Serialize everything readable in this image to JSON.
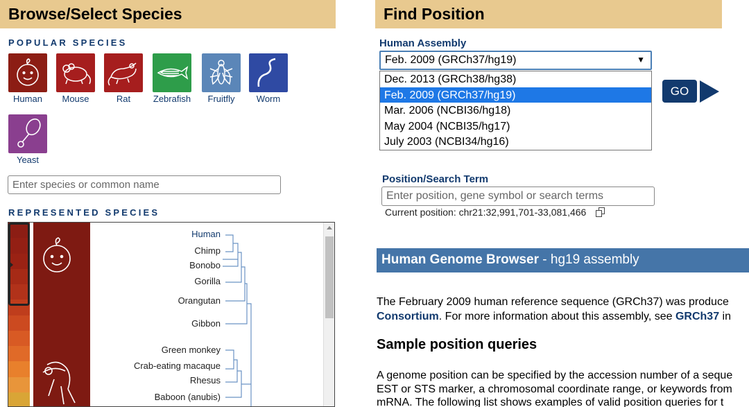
{
  "browse": {
    "title": "Browse/Select Species",
    "popular_label": "POPULAR SPECIES",
    "popular_species": [
      {
        "name": "Human",
        "color": "#8c1d14",
        "icon": "human-icon"
      },
      {
        "name": "Mouse",
        "color": "#a61e1e",
        "icon": "mouse-icon"
      },
      {
        "name": "Rat",
        "color": "#a61e1e",
        "icon": "rat-icon"
      },
      {
        "name": "Zebrafish",
        "color": "#2e9d4a",
        "icon": "zebrafish-icon"
      },
      {
        "name": "Fruitfly",
        "color": "#5b86b8",
        "icon": "fruitfly-icon"
      },
      {
        "name": "Worm",
        "color": "#2f4aa3",
        "icon": "worm-icon"
      },
      {
        "name": "Yeast",
        "color": "#8a3f8f",
        "icon": "yeast-icon"
      }
    ],
    "species_placeholder": "Enter species or common name",
    "represented_label": "REPRESENTED SPECIES",
    "tree_species": [
      "Human",
      "Chimp",
      "Bonobo",
      "Gorilla",
      "Orangutan",
      "Gibbon",
      "Green monkey",
      "Crab-eating macaque",
      "Rhesus",
      "Baboon (anubis)"
    ],
    "strip_colors": [
      "#8c1d14",
      "#931f14",
      "#9a2214",
      "#a62a16",
      "#b1321a",
      "#bf3d1c",
      "#cc4a20",
      "#d85a24",
      "#e06a28",
      "#e8802c",
      "#e8953a",
      "#d9a536"
    ]
  },
  "find": {
    "title": "Find Position",
    "assembly_label": "Human Assembly",
    "selected_assembly": "Feb. 2009 (GRCh37/hg19)",
    "assembly_options": [
      "Dec. 2013 (GRCh38/hg38)",
      "Feb. 2009 (GRCh37/hg19)",
      "Mar. 2006 (NCBI36/hg18)",
      "May 2004 (NCBI35/hg17)",
      "July 2003 (NCBI34/hg16)"
    ],
    "go_label": "GO",
    "search_label": "Position/Search Term",
    "search_placeholder": "Enter position, gene symbol or search terms",
    "current_position": "Current position: chr21:32,991,701-33,081,466"
  },
  "info": {
    "banner_bold": "Human Genome Browser",
    "banner_rest": " - hg19 assembly",
    "desc_line1": "The February 2009 human reference sequence (GRCh37) was produce",
    "desc_line2_link": "Consortium",
    "desc_line2_mid": ". For more information about this assembly, see ",
    "desc_line2_link2": "GRCh37",
    "desc_line2_end": " in",
    "sample_heading": "Sample position queries",
    "sample_line1": "A genome position can be specified by the accession number of a seque",
    "sample_line2": "EST or STS marker, a chromosomal coordinate range, or keywords from",
    "sample_line3": "mRNA. The following list shows examples of valid position queries for t"
  }
}
